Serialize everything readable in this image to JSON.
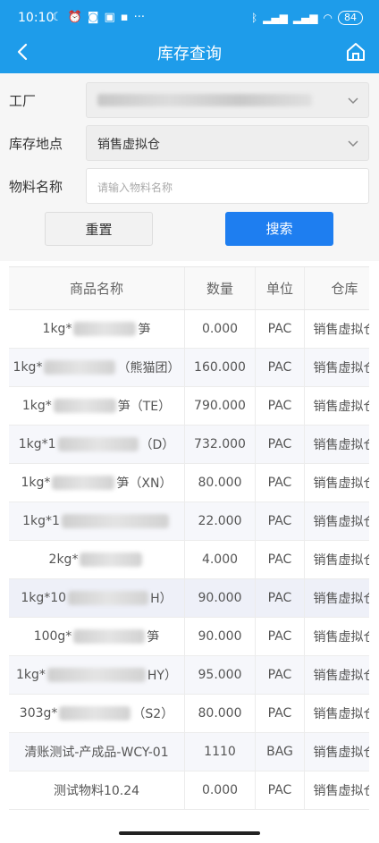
{
  "status_bar": {
    "time": "10:10",
    "battery": "84",
    "dots": "···"
  },
  "header": {
    "title": "库存查询",
    "accent": "#1e9cea"
  },
  "form": {
    "factory_label": "工厂",
    "location_label": "库存地点",
    "location_value": "销售虚拟仓",
    "material_label": "物料名称",
    "material_placeholder": "请输入物料名称"
  },
  "buttons": {
    "reset": "重置",
    "search": "搜索",
    "search_color": "#1e7ef0"
  },
  "table": {
    "columns": [
      "商品名称",
      "数量",
      "单位",
      "仓库"
    ],
    "rows": [
      {
        "name_prefix": "1kg*",
        "name_suffix": "笋",
        "qty": "0.000",
        "unit": "PAC",
        "warehouse": "销售虚拟仓"
      },
      {
        "name_prefix": "1kg*",
        "name_suffix": "（熊猫团）",
        "qty": "160.000",
        "unit": "PAC",
        "warehouse": "销售虚拟仓"
      },
      {
        "name_prefix": "1kg*",
        "name_suffix": "笋（TE）",
        "qty": "790.000",
        "unit": "PAC",
        "warehouse": "销售虚拟仓"
      },
      {
        "name_prefix": "1kg*1",
        "name_suffix": "（D）",
        "qty": "732.000",
        "unit": "PAC",
        "warehouse": "销售虚拟仓"
      },
      {
        "name_prefix": "1kg*",
        "name_suffix": "笋（XN）",
        "qty": "80.000",
        "unit": "PAC",
        "warehouse": "销售虚拟仓"
      },
      {
        "name_prefix": "1kg*1",
        "name_suffix": "",
        "qty": "22.000",
        "unit": "PAC",
        "warehouse": "销售虚拟仓"
      },
      {
        "name_prefix": "2kg*",
        "name_suffix": "",
        "qty": "4.000",
        "unit": "PAC",
        "warehouse": "销售虚拟仓"
      },
      {
        "name_prefix": "1kg*10",
        "name_suffix": "H）",
        "qty": "90.000",
        "unit": "PAC",
        "warehouse": "销售虚拟仓"
      },
      {
        "name_prefix": "100g*",
        "name_suffix": "笋",
        "qty": "90.000",
        "unit": "PAC",
        "warehouse": "销售虚拟仓"
      },
      {
        "name_prefix": "1kg*",
        "name_suffix": "HY）",
        "qty": "95.000",
        "unit": "PAC",
        "warehouse": "销售虚拟仓"
      },
      {
        "name_prefix": "303g*",
        "name_suffix": "（S2）",
        "qty": "80.000",
        "unit": "PAC",
        "warehouse": "销售虚拟仓"
      },
      {
        "name_prefix": "清账测试-产成品-WCY-01",
        "name_suffix": "",
        "qty": "1110",
        "unit": "BAG",
        "warehouse": "销售虚拟仓"
      },
      {
        "name_prefix": "测试物料10.24",
        "name_suffix": "",
        "qty": "0.000",
        "unit": "PAC",
        "warehouse": "销售虚拟仓"
      }
    ]
  }
}
